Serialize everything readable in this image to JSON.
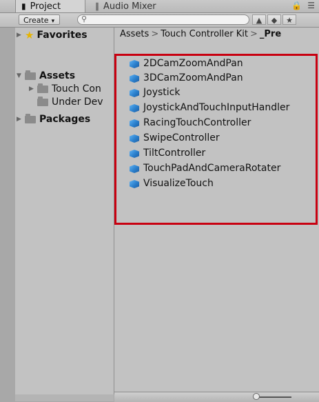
{
  "tabs": {
    "project": {
      "label": "Project",
      "icon": "folder-icon"
    },
    "audio_mixer": {
      "label": "Audio Mixer",
      "icon": "mixer-icon"
    },
    "right_icons": [
      "lock-icon",
      "menu-icon"
    ]
  },
  "toolbar": {
    "create_label": "Create",
    "search_placeholder": "",
    "buttons": [
      "filter-by-type-icon",
      "filter-by-label-icon",
      "favorite-icon"
    ]
  },
  "tree": {
    "favorites": "Favorites",
    "assets": "Assets",
    "touch_controller": "Touch Con",
    "under_dev": "Under Dev",
    "packages": "Packages"
  },
  "breadcrumb": {
    "part1": "Assets",
    "part2": "Touch Controller Kit",
    "part3": "_Pre"
  },
  "assets": [
    "2DCamZoomAndPan",
    "3DCamZoomAndPan",
    "Joystick",
    "JoystickAndTouchInputHandler",
    "RacingTouchController",
    "SwipeController",
    "TiltController",
    "TouchPadAndCameraRotater",
    "VisualizeTouch"
  ],
  "colors": {
    "highlight_border": "#c80010",
    "asset_icon": "#2a7fcc",
    "favorites_star": "#e6b400"
  }
}
